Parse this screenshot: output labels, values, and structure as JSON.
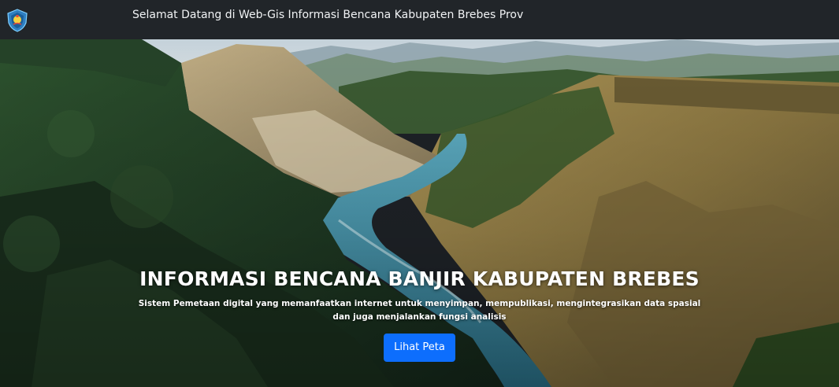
{
  "navbar": {
    "logo_icon": "regency-crest-icon",
    "title": "Selamat Datang di Web-Gis Informasi Bencana Kabupaten Brebes Prov"
  },
  "hero": {
    "heading": "INFORMASI BENCANA BANJIR KABUPATEN BREBES",
    "description": "Sistem Pemetaan digital yang memanfaatkan internet untuk menyimpan, mempublikasi, mengintegrasikan data spasial dan juga menjalankan fungsi analisis",
    "button_label": "Lihat Peta",
    "button_color": "#0d6efd"
  }
}
